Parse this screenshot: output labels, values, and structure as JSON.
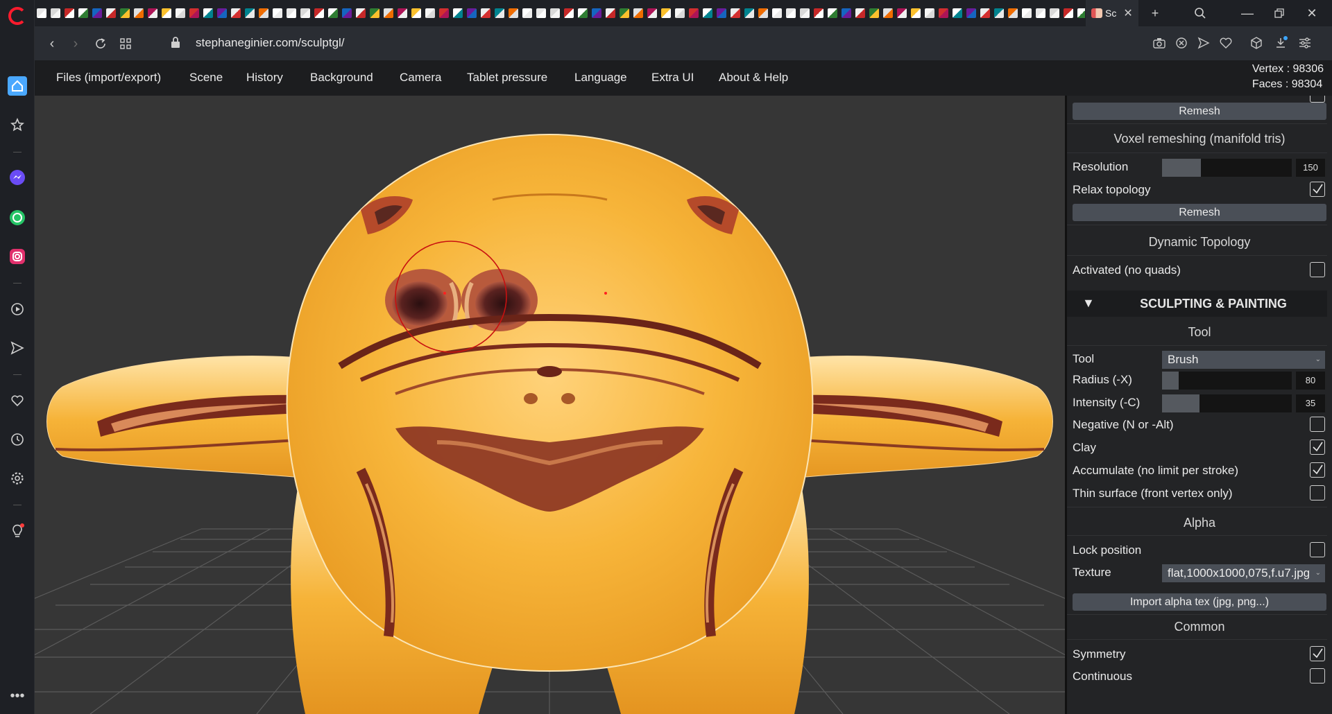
{
  "browser": {
    "active_tab_title": "Sc",
    "url": "stephaneginier.com/sculptgl/",
    "sidebar_icons": [
      "home-icon",
      "star-icon",
      "messenger-icon",
      "whatsapp-icon",
      "instagram-icon",
      "play-icon",
      "send-icon",
      "heart-icon",
      "history-icon",
      "settings-icon",
      "lightbulb-icon",
      "more-icon"
    ]
  },
  "menu": {
    "items": [
      "Files (import/export)",
      "Scene",
      "History",
      "Background",
      "Camera",
      "Tablet pressure",
      "Language",
      "Extra UI",
      "About & Help"
    ],
    "vertex": "Vertex : 98306",
    "faces": "Faces : 98304"
  },
  "panel": {
    "remesh_top": "Remesh",
    "voxel_title": "Voxel remeshing (manifold tris)",
    "resolution_label": "Resolution",
    "resolution_value": "150",
    "resolution_fraction": 0.3,
    "relax_label": "Relax topology",
    "relax_checked": true,
    "remesh_btn": "Remesh",
    "dyntopo_title": "Dynamic Topology",
    "activated_label": "Activated (no quads)",
    "activated_checked": false,
    "sculpt_header": "SCULPTING & PAINTING",
    "tool_title": "Tool",
    "tool_label": "Tool",
    "tool_value": "Brush",
    "radius_label": "Radius (-X)",
    "radius_value": "80",
    "radius_fraction": 0.13,
    "intensity_label": "Intensity (-C)",
    "intensity_value": "35",
    "intensity_fraction": 0.29,
    "negative_label": "Negative (N or -Alt)",
    "negative_checked": false,
    "clay_label": "Clay",
    "clay_checked": true,
    "accumulate_label": "Accumulate (no limit per stroke)",
    "accumulate_checked": true,
    "thin_label": "Thin surface (front vertex only)",
    "thin_checked": false,
    "alpha_title": "Alpha",
    "lock_label": "Lock position",
    "lock_checked": false,
    "texture_label": "Texture",
    "texture_value": "flat,1000x1000,075,f.u7.jpg",
    "import_btn": "Import alpha tex (jpg, png...)",
    "common_title": "Common",
    "symmetry_label": "Symmetry",
    "symmetry_checked": true,
    "continuous_label": "Continuous",
    "continuous_checked": false
  },
  "colors": {
    "mesh_yellow": "#f7b53a",
    "mesh_dark": "#7a2a1c",
    "brush_circle": "#c81010",
    "viewport_bg": "#363636",
    "panel_bg": "#232426"
  }
}
